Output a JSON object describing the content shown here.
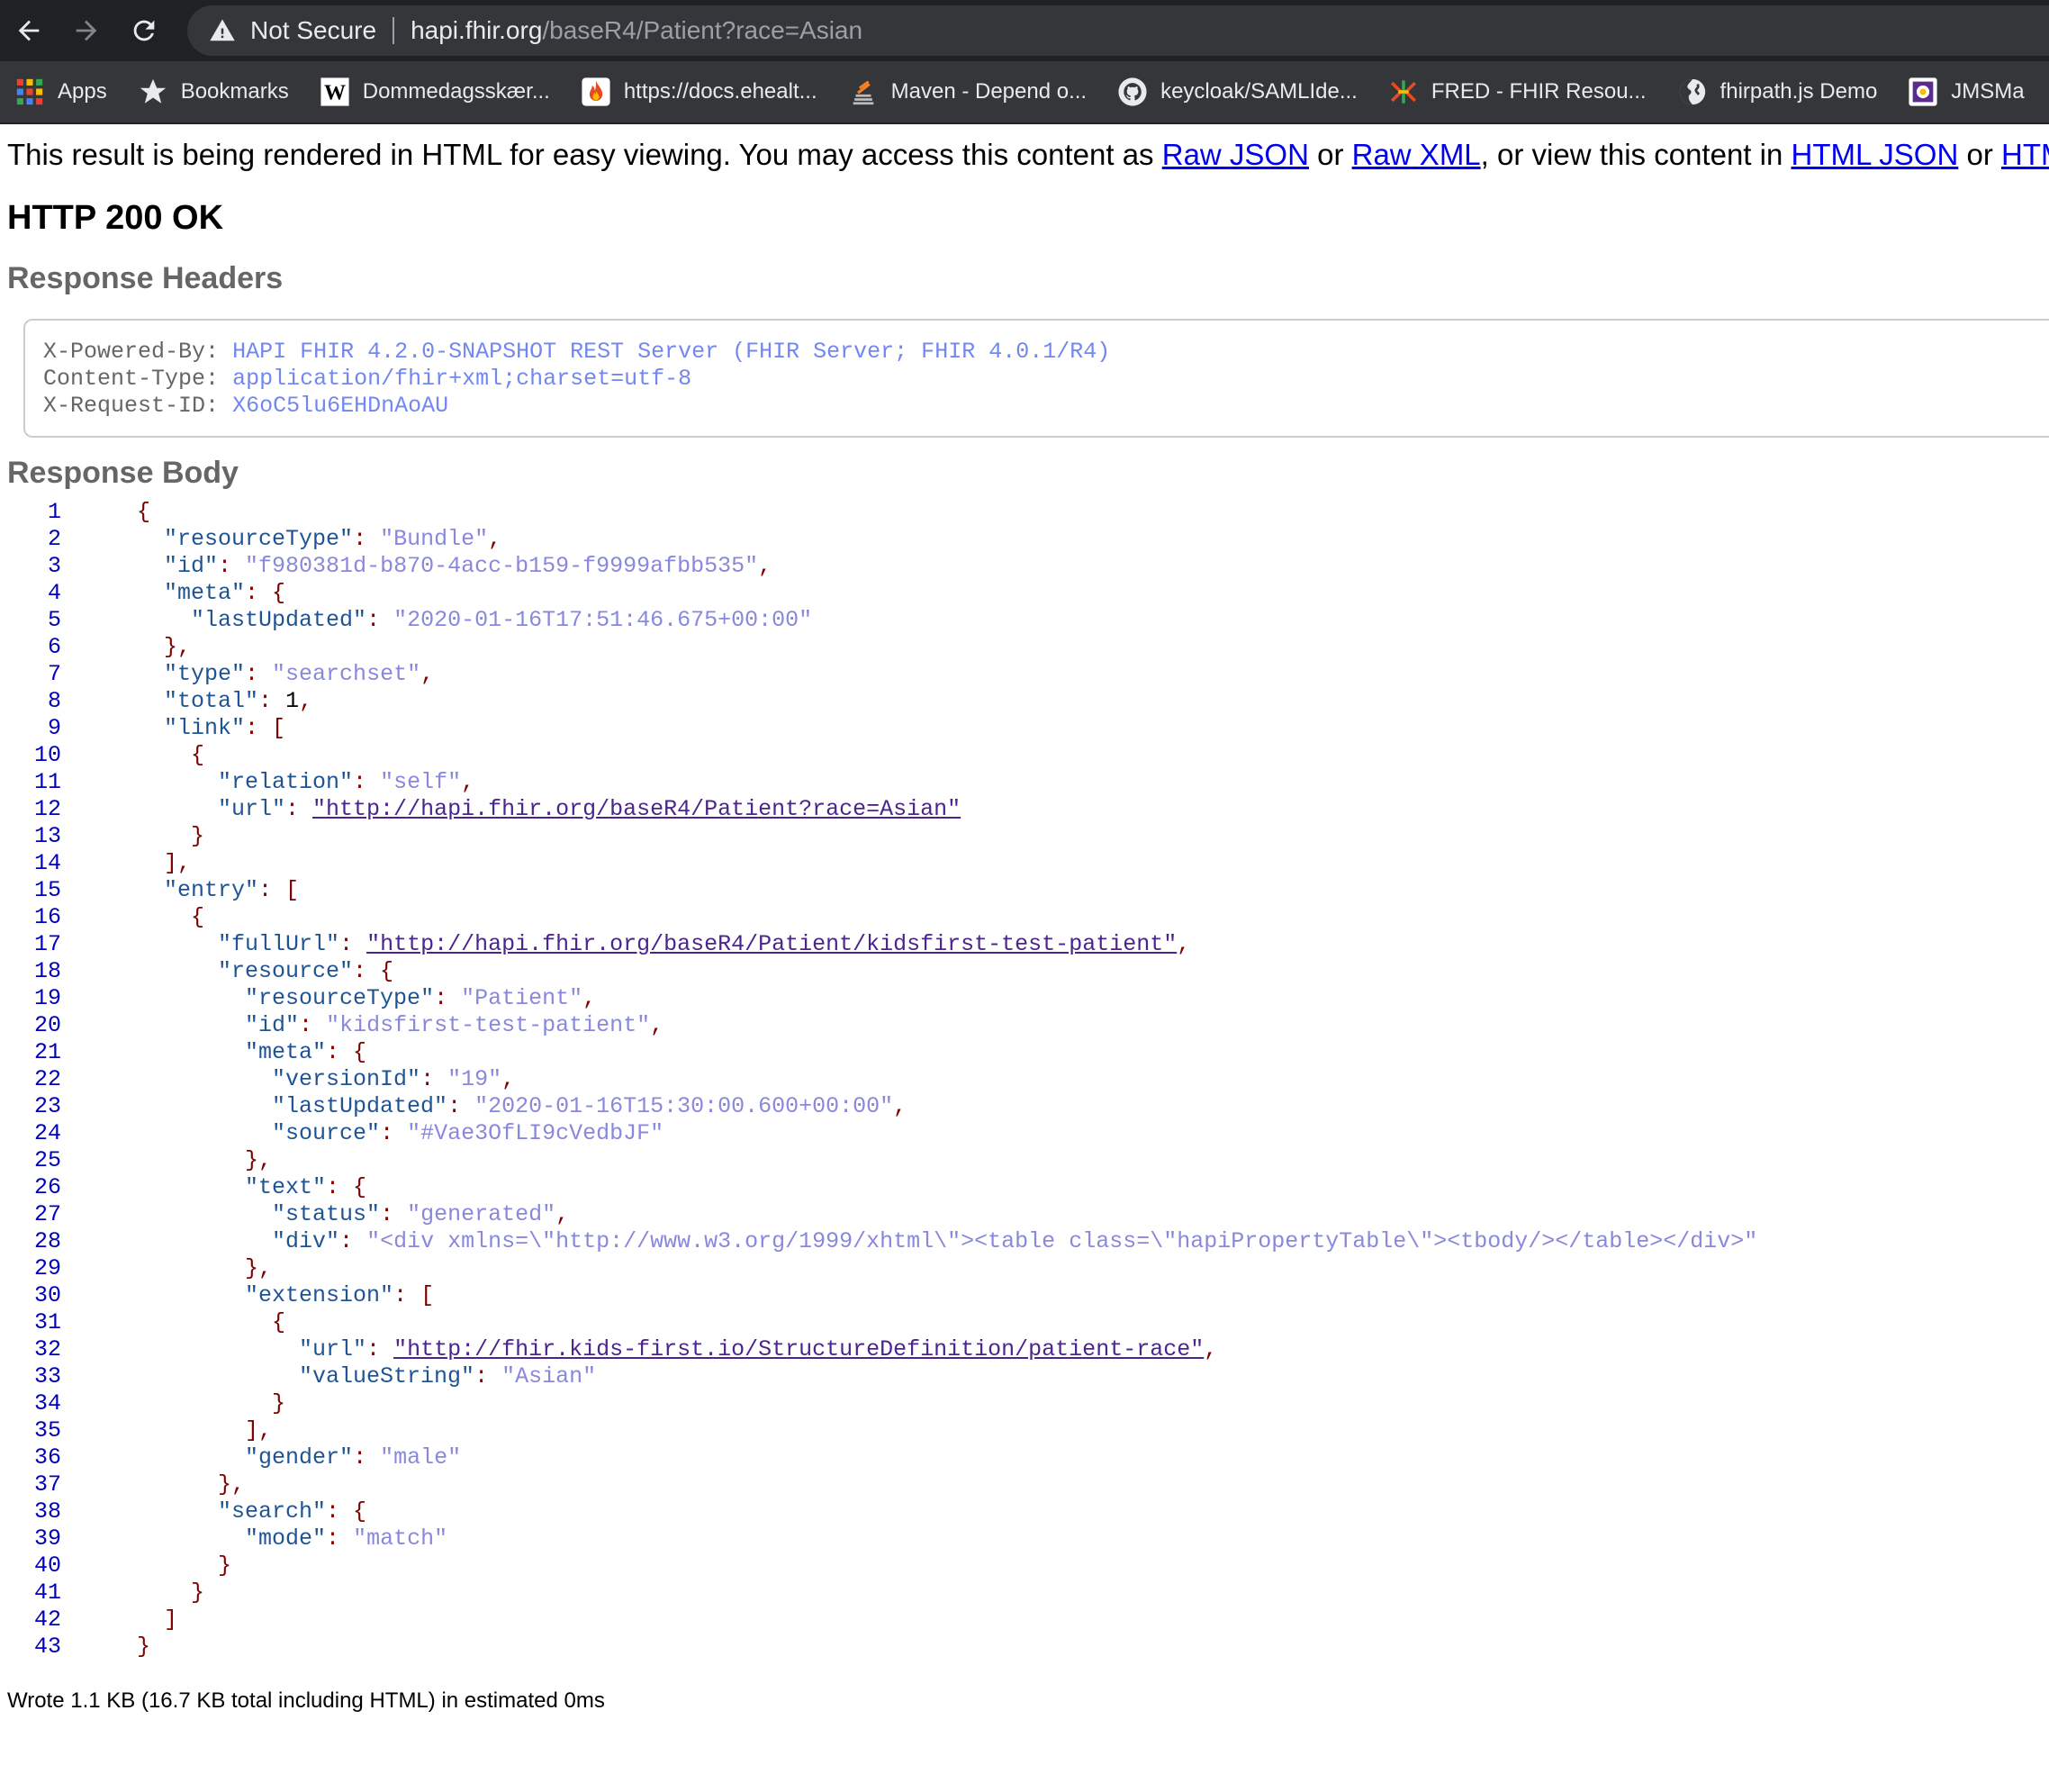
{
  "browser": {
    "security_label": "Not Secure",
    "url_host": "hapi.fhir.org",
    "url_path": "/baseR4/Patient?race=Asian",
    "bookmarks": [
      {
        "label": "Apps",
        "icon": "apps-grid-icon"
      },
      {
        "label": "Bookmarks",
        "icon": "star-icon"
      },
      {
        "label": "Dommedagsskær...",
        "icon": "wikipedia-icon"
      },
      {
        "label": "https://docs.ehealt...",
        "icon": "flame-icon"
      },
      {
        "label": "Maven - Depend o...",
        "icon": "maven-icon"
      },
      {
        "label": "keycloak/SAMLIde...",
        "icon": "github-icon"
      },
      {
        "label": "FRED - FHIR Resou...",
        "icon": "fred-icon"
      },
      {
        "label": "fhirpath.js Demo",
        "icon": "globe-icon"
      },
      {
        "label": "JMSMa",
        "icon": "jms-icon"
      }
    ]
  },
  "page": {
    "notice": {
      "prefix": "This result is being rendered in HTML for easy viewing. You may access this content as ",
      "link1": "Raw JSON",
      "or1": " or ",
      "link2": "Raw XML",
      "mid": ", or view this content in ",
      "link3": "HTML JSON",
      "or2": " or ",
      "link4": "HTML XML"
    },
    "status": "HTTP 200 OK",
    "headers_title": "Response Headers",
    "headers": [
      {
        "key": "X-Powered-By:",
        "value": "HAPI FHIR 4.2.0-SNAPSHOT REST Server (FHIR Server; FHIR 4.0.1/R4)"
      },
      {
        "key": "Content-Type:",
        "value": "application/fhir+xml;charset=utf-8"
      },
      {
        "key": "X-Request-ID:",
        "value": "X6oC5lu6EHDnAoAU"
      }
    ],
    "body_title": "Response Body",
    "footer": "Wrote 1.1 KB (16.7 KB total including HTML) in estimated 0ms",
    "code_lines": [
      {
        "n": "1",
        "indent": 0,
        "parts": [
          [
            "pun",
            "{"
          ]
        ]
      },
      {
        "n": "2",
        "indent": 1,
        "parts": [
          [
            "key",
            "\"resourceType\""
          ],
          [
            "pun",
            ": "
          ],
          [
            "str",
            "\"Bundle\""
          ],
          [
            "pun",
            ","
          ]
        ]
      },
      {
        "n": "3",
        "indent": 1,
        "parts": [
          [
            "key",
            "\"id\""
          ],
          [
            "pun",
            ": "
          ],
          [
            "str",
            "\"f980381d-b870-4acc-b159-f9999afbb535\""
          ],
          [
            "pun",
            ","
          ]
        ]
      },
      {
        "n": "4",
        "indent": 1,
        "parts": [
          [
            "key",
            "\"meta\""
          ],
          [
            "pun",
            ": {"
          ]
        ]
      },
      {
        "n": "5",
        "indent": 2,
        "parts": [
          [
            "key",
            "\"lastUpdated\""
          ],
          [
            "pun",
            ": "
          ],
          [
            "str",
            "\"2020-01-16T17:51:46.675+00:00\""
          ]
        ]
      },
      {
        "n": "6",
        "indent": 1,
        "parts": [
          [
            "pun",
            "},"
          ]
        ]
      },
      {
        "n": "7",
        "indent": 1,
        "parts": [
          [
            "key",
            "\"type\""
          ],
          [
            "pun",
            ": "
          ],
          [
            "str",
            "\"searchset\""
          ],
          [
            "pun",
            ","
          ]
        ]
      },
      {
        "n": "8",
        "indent": 1,
        "parts": [
          [
            "key",
            "\"total\""
          ],
          [
            "pun",
            ": "
          ],
          [
            "num",
            "1"
          ],
          [
            "pun",
            ","
          ]
        ]
      },
      {
        "n": "9",
        "indent": 1,
        "parts": [
          [
            "key",
            "\"link\""
          ],
          [
            "pun",
            ": ["
          ]
        ]
      },
      {
        "n": "10",
        "indent": 2,
        "parts": [
          [
            "pun",
            "{"
          ]
        ]
      },
      {
        "n": "11",
        "indent": 3,
        "parts": [
          [
            "key",
            "\"relation\""
          ],
          [
            "pun",
            ": "
          ],
          [
            "str",
            "\"self\""
          ],
          [
            "pun",
            ","
          ]
        ]
      },
      {
        "n": "12",
        "indent": 3,
        "parts": [
          [
            "key",
            "\"url\""
          ],
          [
            "pun",
            ": "
          ],
          [
            "lnk",
            "\"http://hapi.fhir.org/baseR4/Patient?race=Asian\""
          ]
        ]
      },
      {
        "n": "13",
        "indent": 2,
        "parts": [
          [
            "pun",
            "}"
          ]
        ]
      },
      {
        "n": "14",
        "indent": 1,
        "parts": [
          [
            "pun",
            "],"
          ]
        ]
      },
      {
        "n": "15",
        "indent": 1,
        "parts": [
          [
            "key",
            "\"entry\""
          ],
          [
            "pun",
            ": ["
          ]
        ]
      },
      {
        "n": "16",
        "indent": 2,
        "parts": [
          [
            "pun",
            "{"
          ]
        ]
      },
      {
        "n": "17",
        "indent": 3,
        "parts": [
          [
            "key",
            "\"fullUrl\""
          ],
          [
            "pun",
            ": "
          ],
          [
            "lnk",
            "\"http://hapi.fhir.org/baseR4/Patient/kidsfirst-test-patient\""
          ],
          [
            "pun",
            ","
          ]
        ]
      },
      {
        "n": "18",
        "indent": 3,
        "parts": [
          [
            "key",
            "\"resource\""
          ],
          [
            "pun",
            ": {"
          ]
        ]
      },
      {
        "n": "19",
        "indent": 4,
        "parts": [
          [
            "key",
            "\"resourceType\""
          ],
          [
            "pun",
            ": "
          ],
          [
            "str",
            "\"Patient\""
          ],
          [
            "pun",
            ","
          ]
        ]
      },
      {
        "n": "20",
        "indent": 4,
        "parts": [
          [
            "key",
            "\"id\""
          ],
          [
            "pun",
            ": "
          ],
          [
            "str",
            "\"kidsfirst-test-patient\""
          ],
          [
            "pun",
            ","
          ]
        ]
      },
      {
        "n": "21",
        "indent": 4,
        "parts": [
          [
            "key",
            "\"meta\""
          ],
          [
            "pun",
            ": {"
          ]
        ]
      },
      {
        "n": "22",
        "indent": 5,
        "parts": [
          [
            "key",
            "\"versionId\""
          ],
          [
            "pun",
            ": "
          ],
          [
            "str",
            "\"19\""
          ],
          [
            "pun",
            ","
          ]
        ]
      },
      {
        "n": "23",
        "indent": 5,
        "parts": [
          [
            "key",
            "\"lastUpdated\""
          ],
          [
            "pun",
            ": "
          ],
          [
            "str",
            "\"2020-01-16T15:30:00.600+00:00\""
          ],
          [
            "pun",
            ","
          ]
        ]
      },
      {
        "n": "24",
        "indent": 5,
        "parts": [
          [
            "key",
            "\"source\""
          ],
          [
            "pun",
            ": "
          ],
          [
            "str",
            "\"#Vae3OfLI9cVedbJF\""
          ]
        ]
      },
      {
        "n": "25",
        "indent": 4,
        "parts": [
          [
            "pun",
            "},"
          ]
        ]
      },
      {
        "n": "26",
        "indent": 4,
        "parts": [
          [
            "key",
            "\"text\""
          ],
          [
            "pun",
            ": {"
          ]
        ]
      },
      {
        "n": "27",
        "indent": 5,
        "parts": [
          [
            "key",
            "\"status\""
          ],
          [
            "pun",
            ": "
          ],
          [
            "str",
            "\"generated\""
          ],
          [
            "pun",
            ","
          ]
        ]
      },
      {
        "n": "28",
        "indent": 5,
        "parts": [
          [
            "key",
            "\"div\""
          ],
          [
            "pun",
            ": "
          ],
          [
            "str",
            "\"<div xmlns=\\\"http://www.w3.org/1999/xhtml\\\"><table class=\\\"hapiPropertyTable\\\"><tbody/></table></div>\""
          ]
        ]
      },
      {
        "n": "29",
        "indent": 4,
        "parts": [
          [
            "pun",
            "},"
          ]
        ]
      },
      {
        "n": "30",
        "indent": 4,
        "parts": [
          [
            "key",
            "\"extension\""
          ],
          [
            "pun",
            ": ["
          ]
        ]
      },
      {
        "n": "31",
        "indent": 5,
        "parts": [
          [
            "pun",
            "{"
          ]
        ]
      },
      {
        "n": "32",
        "indent": 6,
        "parts": [
          [
            "key",
            "\"url\""
          ],
          [
            "pun",
            ": "
          ],
          [
            "lnk",
            "\"http://fhir.kids-first.io/StructureDefinition/patient-race\""
          ],
          [
            "pun",
            ","
          ]
        ]
      },
      {
        "n": "33",
        "indent": 6,
        "parts": [
          [
            "key",
            "\"valueString\""
          ],
          [
            "pun",
            ": "
          ],
          [
            "str",
            "\"Asian\""
          ]
        ]
      },
      {
        "n": "34",
        "indent": 5,
        "parts": [
          [
            "pun",
            "}"
          ]
        ]
      },
      {
        "n": "35",
        "indent": 4,
        "parts": [
          [
            "pun",
            "],"
          ]
        ]
      },
      {
        "n": "36",
        "indent": 4,
        "parts": [
          [
            "key",
            "\"gender\""
          ],
          [
            "pun",
            ": "
          ],
          [
            "str",
            "\"male\""
          ]
        ]
      },
      {
        "n": "37",
        "indent": 3,
        "parts": [
          [
            "pun",
            "},"
          ]
        ]
      },
      {
        "n": "38",
        "indent": 3,
        "parts": [
          [
            "key",
            "\"search\""
          ],
          [
            "pun",
            ": {"
          ]
        ]
      },
      {
        "n": "39",
        "indent": 4,
        "parts": [
          [
            "key",
            "\"mode\""
          ],
          [
            "pun",
            ": "
          ],
          [
            "str",
            "\"match\""
          ]
        ]
      },
      {
        "n": "40",
        "indent": 3,
        "parts": [
          [
            "pun",
            "}"
          ]
        ]
      },
      {
        "n": "41",
        "indent": 2,
        "parts": [
          [
            "pun",
            "}"
          ]
        ]
      },
      {
        "n": "42",
        "indent": 1,
        "parts": [
          [
            "pun",
            "]"
          ]
        ]
      },
      {
        "n": "43",
        "indent": 0,
        "parts": [
          [
            "pun",
            "}"
          ]
        ]
      }
    ]
  }
}
